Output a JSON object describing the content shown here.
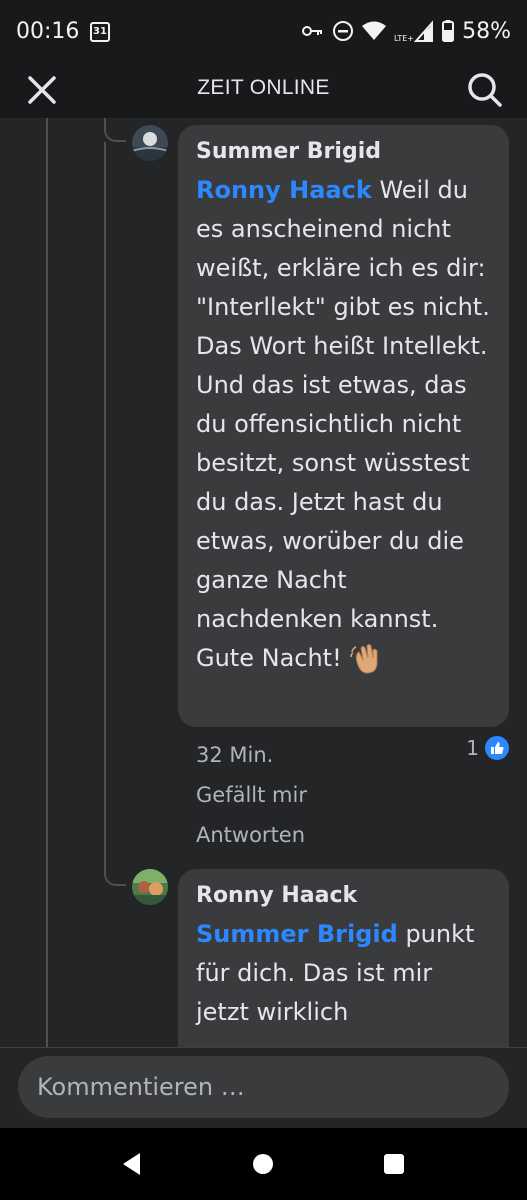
{
  "status_bar": {
    "time": "00:16",
    "calendar_day": "31",
    "battery": "58%",
    "network": "LTE+"
  },
  "header": {
    "title": "ZEIT ONLINE"
  },
  "comments": [
    {
      "author": "Summer Brigid",
      "mention": "Ronny Haack",
      "text": "Weil du es anscheinend nicht weißt, erkläre ich es dir: \"Interllekt\" gibt es nicht. Das Wort heißt Intellekt. Und das ist etwas, das du offensichtlich nicht besitzt, sonst wüsstest du das. Jetzt hast du etwas, worüber du die ganze Nacht nachdenken kannst. Gute Nacht!",
      "time": "32 Min.",
      "like_label": "Gefällt mir",
      "reply_label": "Antworten",
      "reaction_count": "1"
    },
    {
      "author": "Ronny Haack",
      "mention": "Summer Brigid",
      "text": "punkt für dich. Das ist mir jetzt wirklich"
    }
  ],
  "composer": {
    "placeholder": "Kommentieren …"
  },
  "colors": {
    "background": "#242526",
    "bubble": "#3a3b3c",
    "mention": "#2d88ff",
    "like_badge": "#2d88ff"
  },
  "icons": [
    "close-icon",
    "search-icon",
    "like-icon",
    "back-icon",
    "home-icon",
    "recents-icon",
    "wifi-icon",
    "battery-icon",
    "key-icon",
    "dnd-icon",
    "signal-icon",
    "calendar-icon"
  ]
}
